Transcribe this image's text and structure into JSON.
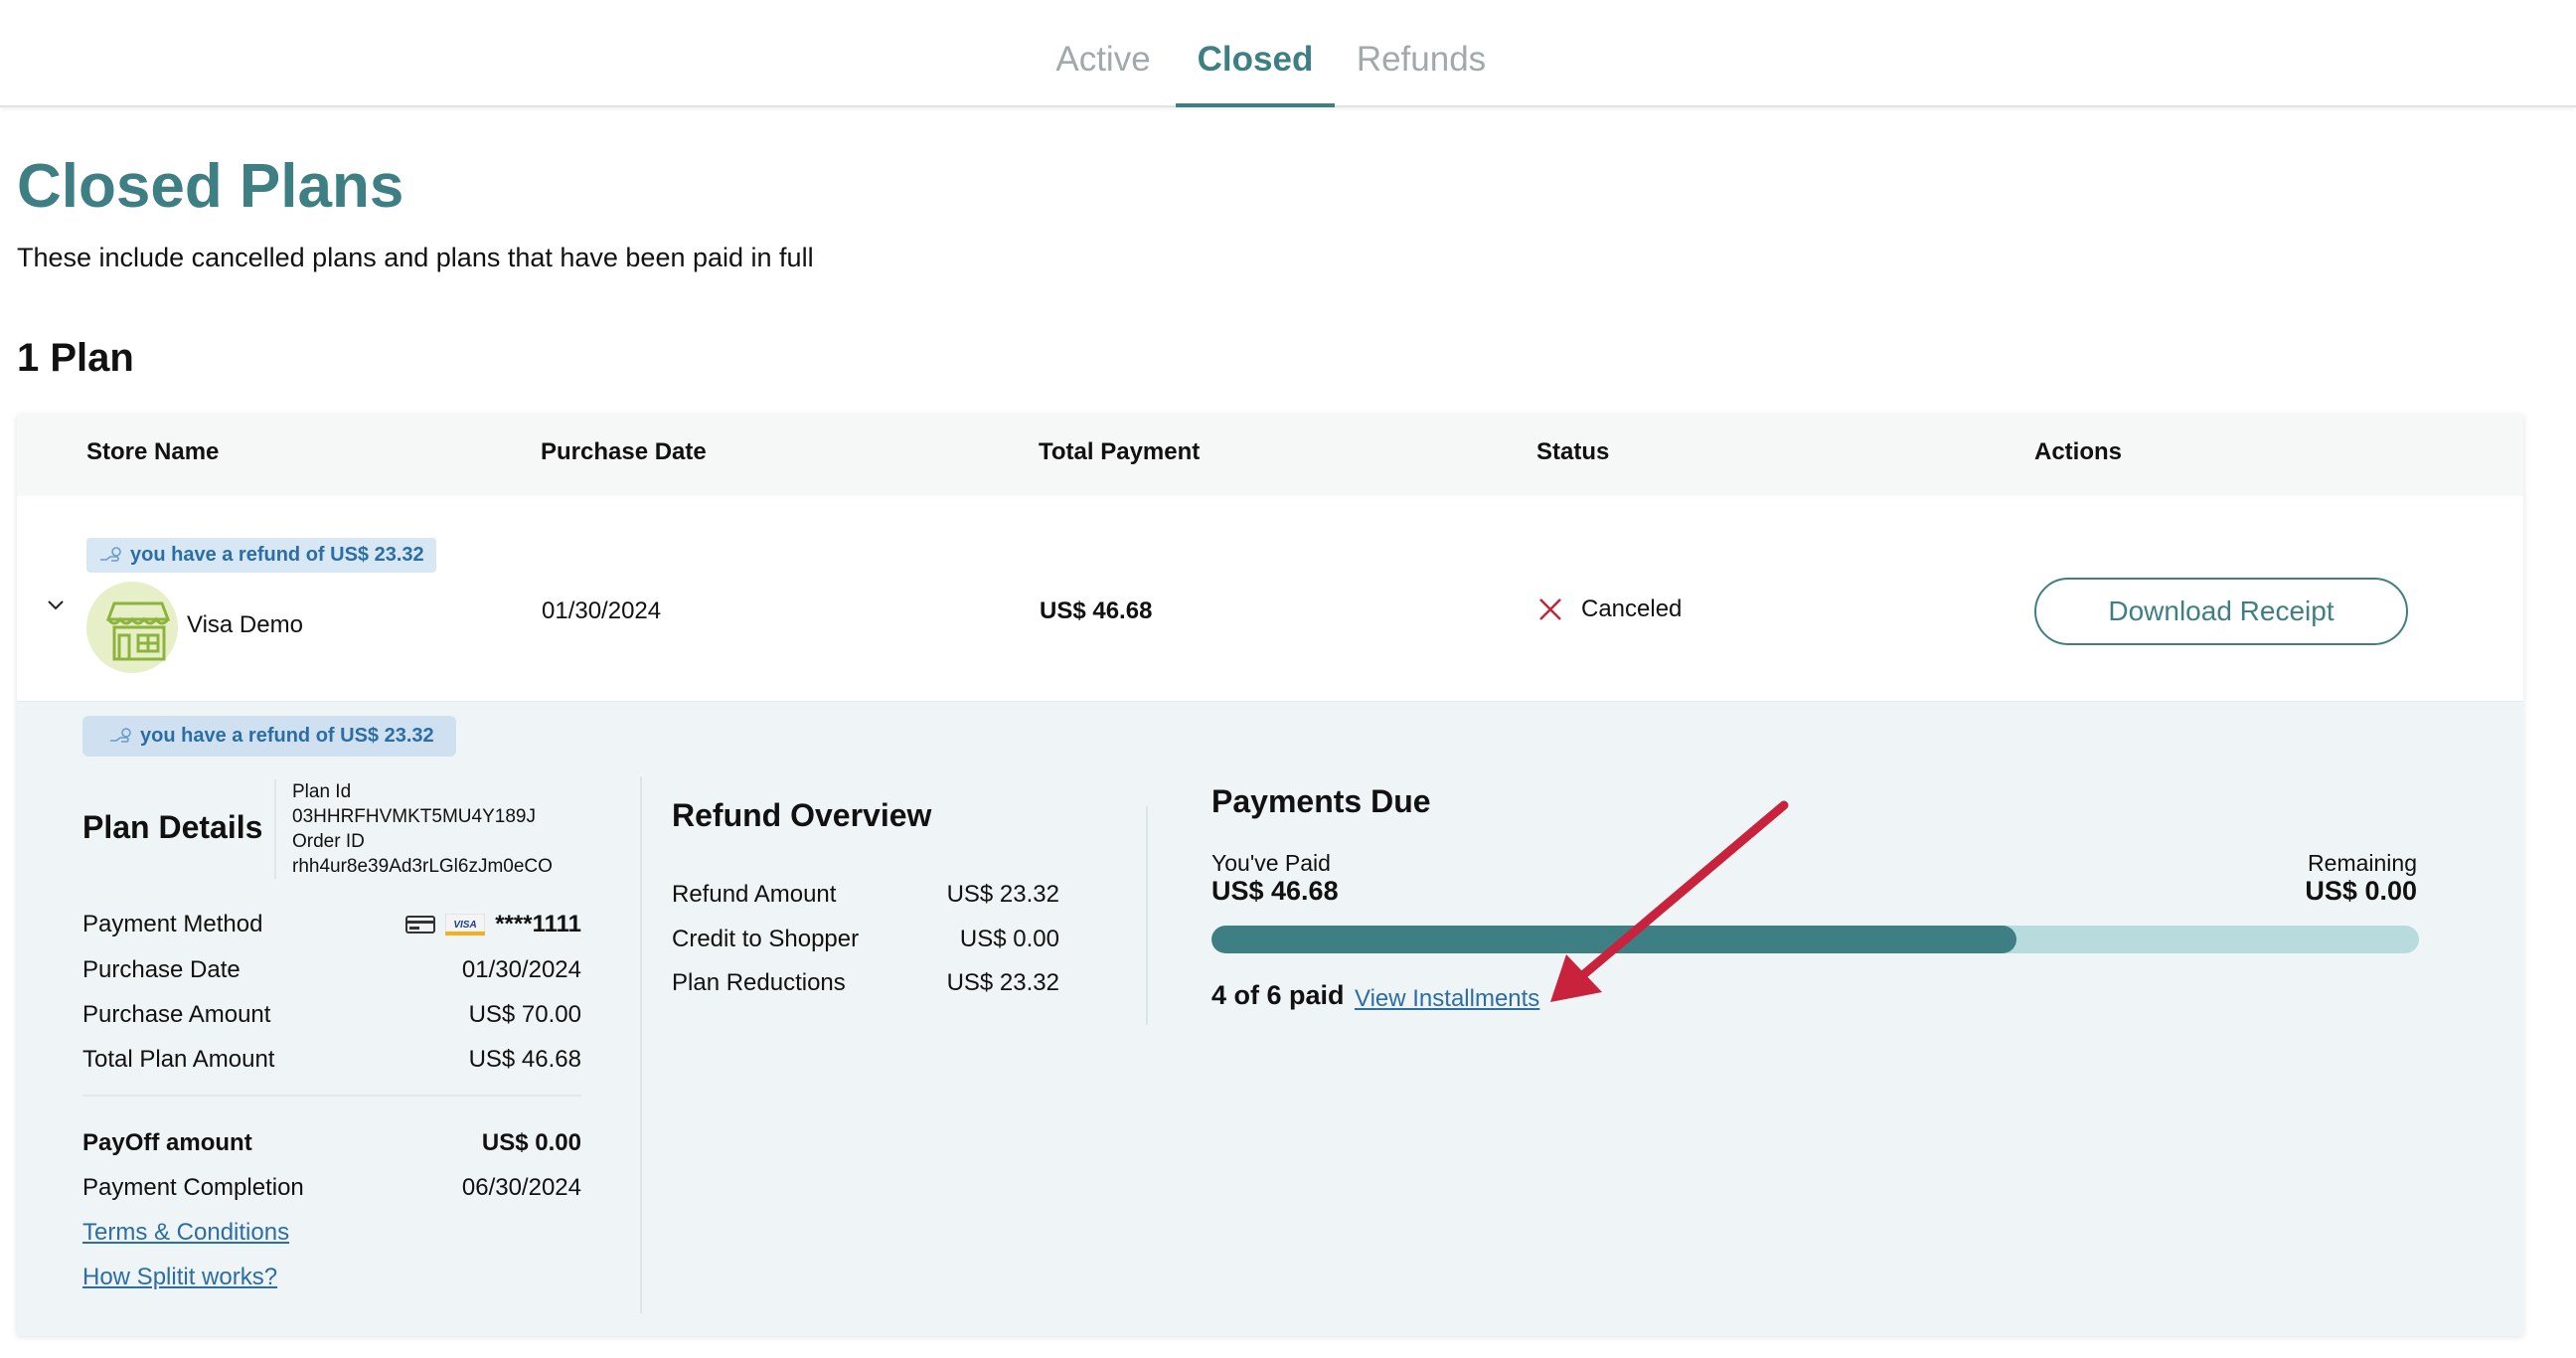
{
  "tabs": [
    {
      "label": "Active"
    },
    {
      "label": "Closed"
    },
    {
      "label": "Refunds"
    }
  ],
  "page": {
    "title": "Closed Plans",
    "subtitle": "These include cancelled plans and plans that have been paid in full",
    "plan_count": "1 Plan"
  },
  "table": {
    "headers": [
      "Store Name",
      "Purchase Date",
      "Total Payment",
      "Status",
      "Actions"
    ],
    "row": {
      "refund_badge": "you have a refund of US$ 23.32",
      "store_name": "Visa Demo",
      "purchase_date": "01/30/2024",
      "total_payment": "US$ 46.68",
      "status": "Canceled",
      "action_label": "Download Receipt"
    }
  },
  "detail": {
    "refund_badge": "you have a refund of US$ 23.32",
    "plan_details": {
      "title": "Plan Details",
      "plan_id_label": "Plan Id",
      "plan_id": "03HHRFHVMKT5MU4Y189J",
      "order_id_label": "Order ID",
      "order_id": "rhh4ur8e39Ad3rLGl6zJm0eCO",
      "payment_method_label": "Payment Method",
      "card_mask": "****1111",
      "purchase_date_label": "Purchase Date",
      "purchase_date": "01/30/2024",
      "purchase_amount_label": "Purchase Amount",
      "purchase_amount": "US$ 70.00",
      "total_plan_amount_label": "Total Plan Amount",
      "total_plan_amount": "US$ 46.68",
      "payoff_label": "PayOff amount",
      "payoff_amount": "US$ 0.00",
      "completion_label": "Payment Completion",
      "completion_date": "06/30/2024",
      "terms_link": "Terms & Conditions",
      "how_link": "How Splitit works?"
    },
    "refund_overview": {
      "title": "Refund Overview",
      "rows": [
        {
          "label": "Refund Amount",
          "value": "US$ 23.32"
        },
        {
          "label": "Credit to Shopper",
          "value": "US$ 0.00"
        },
        {
          "label": "Plan Reductions",
          "value": "US$ 23.32"
        }
      ]
    },
    "payments_due": {
      "title": "Payments Due",
      "paid_label": "You've Paid",
      "paid_amount": "US$ 46.68",
      "remaining_label": "Remaining",
      "remaining_amount": "US$ 0.00",
      "progress_fraction": 0.667,
      "paid_count": "4 of 6 paid",
      "view_link": "View Installments"
    }
  },
  "colors": {
    "accent": "#3e7f84",
    "link": "#2c6da5",
    "cancel_x": "#c0283c",
    "arrow": "#c8223c",
    "badge_bg": "#d7e8f4"
  },
  "icons": [
    "chevron-down-icon",
    "store-icon",
    "refund-hand-icon",
    "close-x-icon",
    "credit-card-icon",
    "visa-icon",
    "annotation-arrow"
  ]
}
